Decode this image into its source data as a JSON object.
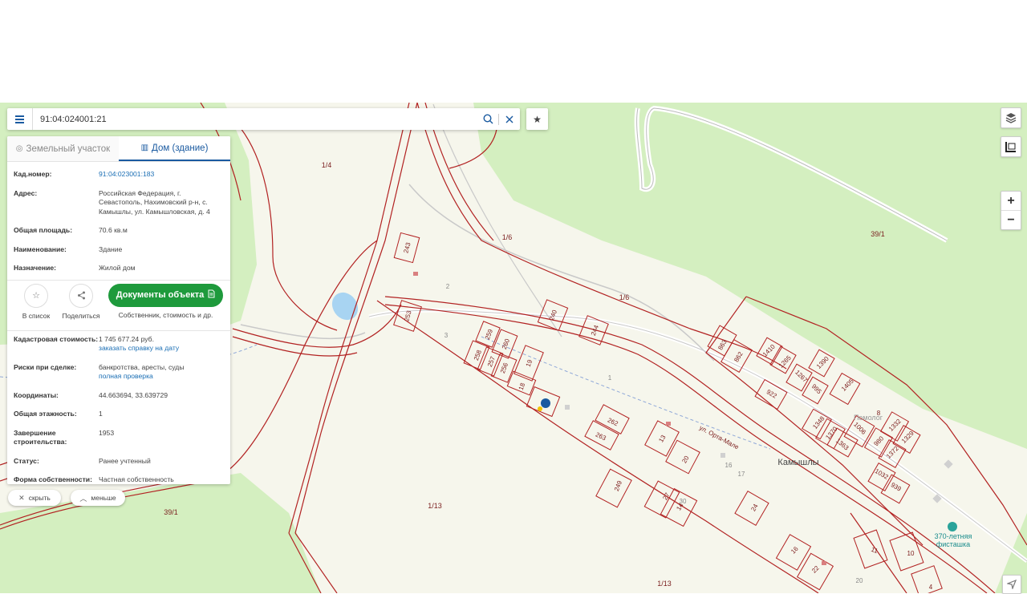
{
  "search": {
    "value": "91:04:024001:21",
    "placeholder": ""
  },
  "tabs": [
    {
      "label": "Земельный участок",
      "icon": "parcel-icon",
      "active": false
    },
    {
      "label": "Дом (здание)",
      "icon": "building-icon",
      "active": true
    }
  ],
  "details": {
    "cad_number": {
      "label": "Кад.номер:",
      "value": "91:04:023001:183"
    },
    "address": {
      "label": "Адрес:",
      "value": "Российская Федерация, г. Севастополь, Нахимовский р-н, с. Камышлы, ул. Камышловская, д. 4"
    },
    "area": {
      "label": "Общая площадь:",
      "value": "70.6 кв.м"
    },
    "name": {
      "label": "Наименование:",
      "value": "Здание"
    },
    "purpose": {
      "label": "Назначение:",
      "value": "Жилой дом"
    }
  },
  "actions": {
    "favorite_label": "В список",
    "share_label": "Поделиться",
    "docs_button": "Документы объекта",
    "docs_sub": "Собственник, стоимость и др."
  },
  "details2": {
    "cad_cost": {
      "label": "Кадастровая стоимость:",
      "value": "1 745 677.24 руб.",
      "link": "заказать справку на дату"
    },
    "risks": {
      "label": "Риски при сделке:",
      "value": "банкротства, аресты, суды",
      "link": "полная проверка"
    },
    "coords": {
      "label": "Координаты:",
      "value": "44.663694, 33.639729"
    },
    "floors": {
      "label": "Общая этажность:",
      "value": "1"
    },
    "completed": {
      "label": "Завершение строительства:",
      "value": "1953"
    },
    "status": {
      "label": "Статус:",
      "value": "Ранее учтенный"
    },
    "ownership": {
      "label": "Форма собственности:",
      "value": "Частная собственность"
    }
  },
  "pills": {
    "hide": "скрыть",
    "less": "меньше"
  },
  "map": {
    "quarter_labels": [
      "1/4",
      "1/6",
      "1/6",
      "39/1",
      "1/13",
      "39/1",
      "1/13"
    ],
    "village": "Камышлы",
    "street": "ул. Орта-Мале",
    "poi": [
      "370-летняя",
      "фисташка"
    ],
    "place_faint": "Помолог",
    "plots": [
      "243",
      "253",
      "240",
      "244",
      "259",
      "260",
      "258",
      "257",
      "256",
      "19",
      "18",
      "262",
      "263",
      "13",
      "20",
      "249",
      "27",
      "14",
      "24",
      "863",
      "862",
      "1410",
      "1265",
      "1390",
      "1267",
      "995",
      "1405",
      "922",
      "8",
      "1332",
      "1348",
      "1370",
      "1006",
      "980",
      "1329",
      "1363",
      "1372",
      "1032",
      "939",
      "16",
      "22",
      "11",
      "10",
      "4",
      "2",
      "3",
      "1",
      "16",
      "17",
      "30",
      "20"
    ]
  },
  "colors": {
    "boundary": "#b22222",
    "green": "#d4efc0",
    "docs_green": "#1e9a3c",
    "link": "#1a6eb4"
  }
}
